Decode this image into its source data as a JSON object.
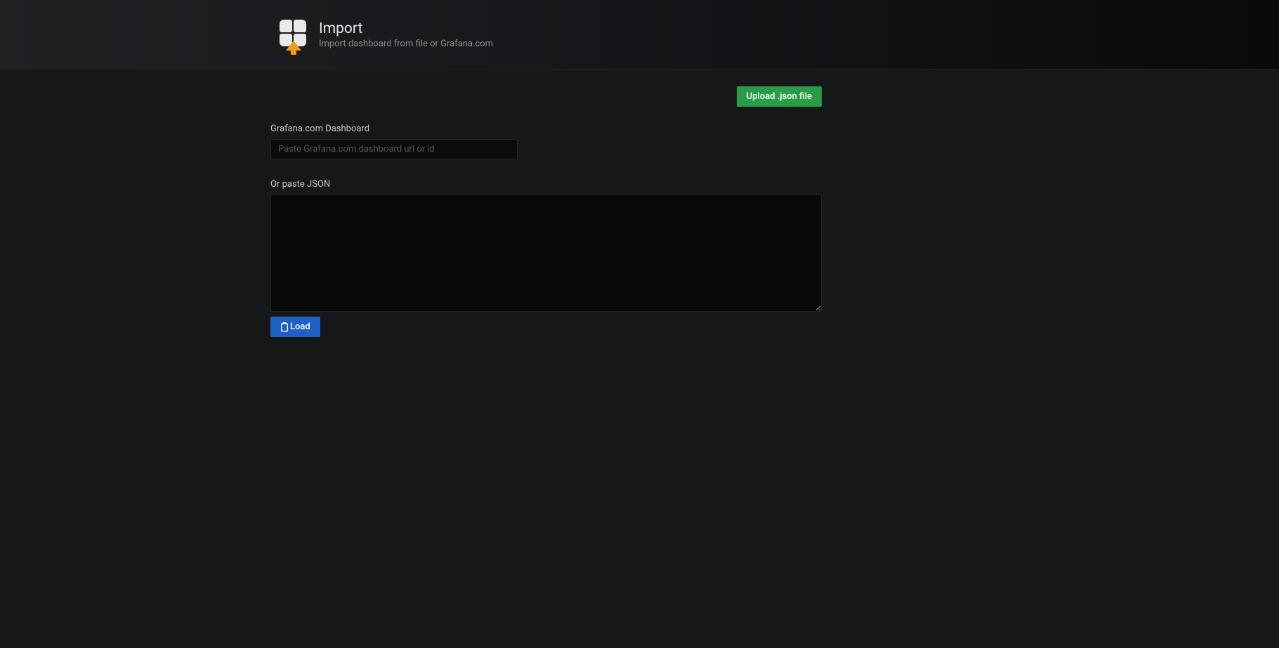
{
  "header": {
    "title": "Import",
    "subtitle": "Import dashboard from file or Grafana.com"
  },
  "buttons": {
    "upload": "Upload .json file",
    "load": "Load"
  },
  "form": {
    "dashboard_label": "Grafana.com Dashboard",
    "dashboard_placeholder": "Paste Grafana.com dashboard url or id",
    "json_label": "Or paste JSON"
  }
}
